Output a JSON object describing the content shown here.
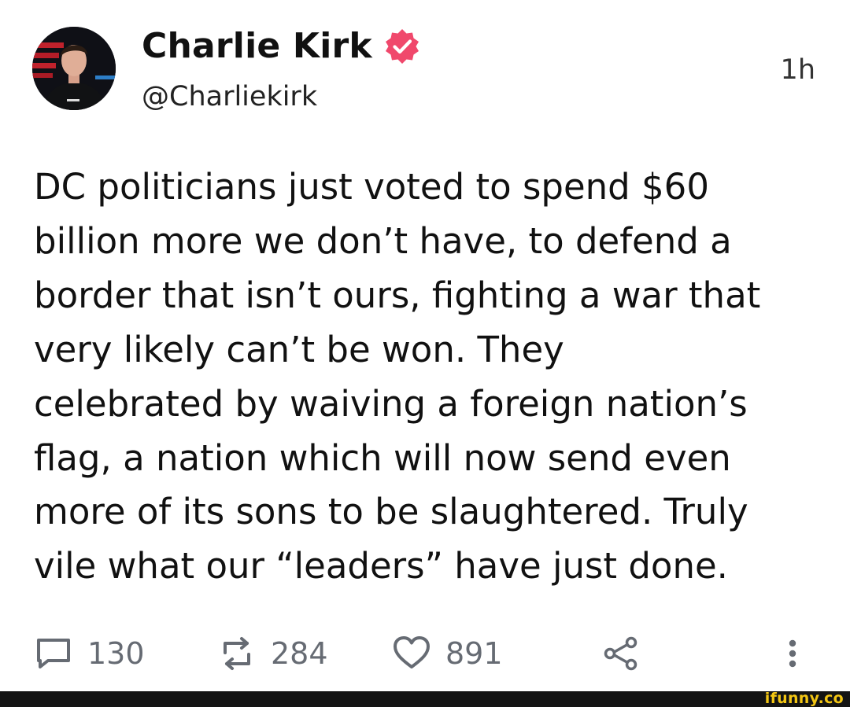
{
  "author": {
    "display_name": "Charlie Kirk",
    "handle": "@Charliekirk",
    "avatar_icon": "profile-photo",
    "verified_icon": "verified-badge-icon",
    "verified_color": "#f0486c"
  },
  "post": {
    "time": "1h",
    "text": "DC politicians just voted to spend $60\nbillion more we don’t have, to defend a\nborder that isn’t ours, fighting a war that\nvery likely can’t be won. They\ncelebrated by waiving a foreign nation’s\nflag, a nation which will now send even\nmore of its sons to be slaughtered. Truly\nvile what our “leaders” have just done."
  },
  "actions": {
    "reply": {
      "icon": "comment-icon",
      "count": "130"
    },
    "repost": {
      "icon": "repost-icon",
      "count": "284"
    },
    "like": {
      "icon": "heart-icon",
      "count": "891"
    },
    "share": {
      "icon": "share-icon"
    },
    "more": {
      "icon": "more-vertical-icon"
    },
    "icon_color": "#666b73"
  },
  "watermark": {
    "text": "ifunny.co",
    "color": "#f3c614"
  }
}
